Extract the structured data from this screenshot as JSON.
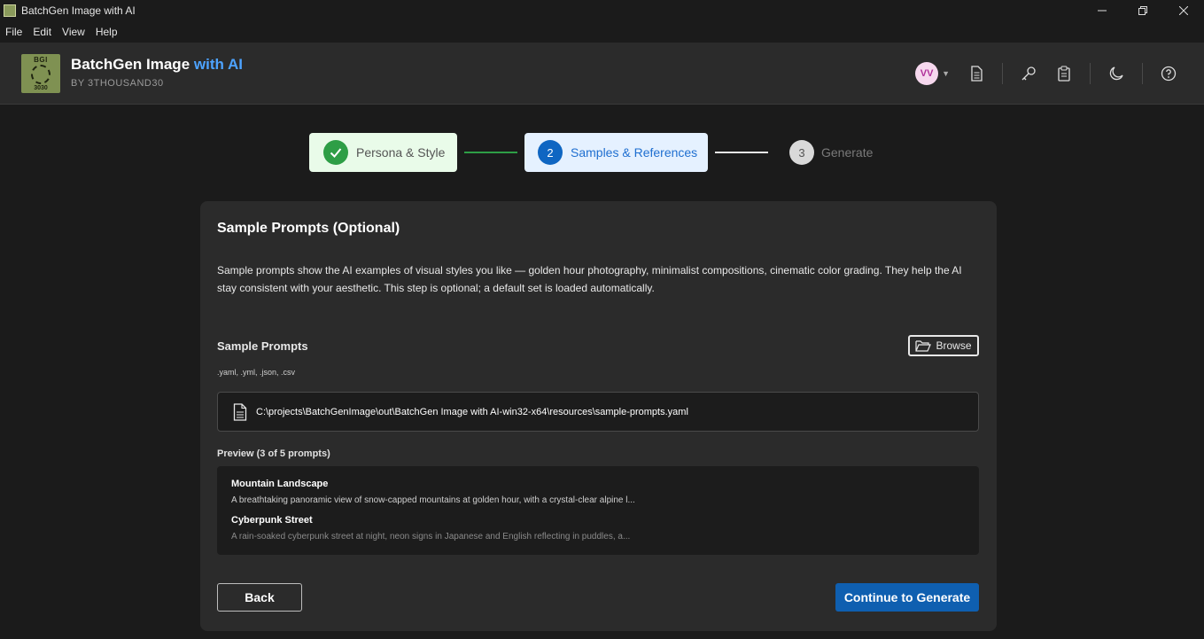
{
  "window": {
    "title": "BatchGen Image with AI",
    "controls": {
      "minimize_icon": "minimize-icon",
      "maximize_icon": "restore-icon",
      "close_icon": "close-icon"
    }
  },
  "menu": [
    "File",
    "Edit",
    "View",
    "Help"
  ],
  "header": {
    "logo_top": "BGI",
    "logo_bottom": "3030",
    "title_main": "BatchGen Image",
    "title_accent": "with AI",
    "subtitle": "BY 3THOUSAND30",
    "avatar_initials": "VV",
    "icons": [
      "document-icon",
      "key-icon",
      "clipboard-icon",
      "moon-icon",
      "help-icon"
    ]
  },
  "stepper": {
    "steps": [
      {
        "number": "1",
        "label": "Persona & Style",
        "state": "done"
      },
      {
        "number": "2",
        "label": "Samples & References",
        "state": "active"
      },
      {
        "number": "3",
        "label": "Generate",
        "state": "pending"
      }
    ]
  },
  "card": {
    "title": "Sample Prompts (Optional)",
    "description": "Sample prompts show the AI examples of visual styles you like — golden hour photography, minimalist compositions, cinematic color grading. They help the AI stay consistent with your aesthetic. This step is optional; a default set is loaded automatically.",
    "sample_prompts_label": "Sample Prompts",
    "browse_label": "Browse",
    "extensions_hint": ".yaml, .yml, .json, .csv",
    "file_path": "C:\\projects\\BatchGenImage\\out\\BatchGen Image with AI-win32-x64\\resources\\sample-prompts.yaml",
    "preview_label": "Preview (3 of 5 prompts)",
    "preview_items": [
      {
        "name": "Mountain Landscape",
        "text": "A breathtaking panoramic view of snow-capped mountains at golden hour, with a crystal-clear alpine l..."
      },
      {
        "name": "Cyberpunk Street",
        "text": "A rain-soaked cyberpunk street at night, neon signs in Japanese and English reflecting in puddles, a..."
      }
    ],
    "back_label": "Back",
    "continue_label": "Continue to Generate"
  },
  "colors": {
    "accent": "#4da3ff",
    "primary_button": "#0f5fb0",
    "step_done": "#2e9e46",
    "step_active": "#0f66c2"
  }
}
